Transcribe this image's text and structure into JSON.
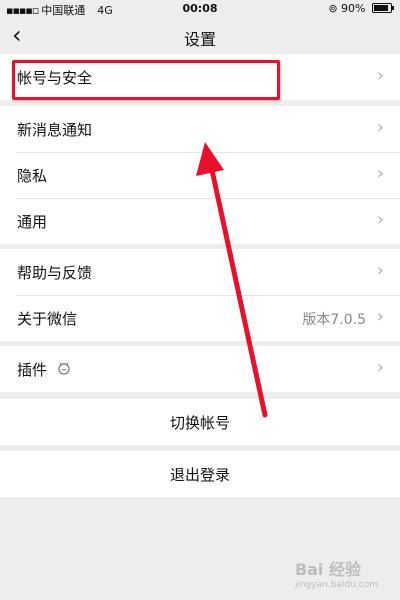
{
  "status_bar": {
    "carrier": "中国联通",
    "network": "4G",
    "time": "00:08",
    "battery": "90%",
    "battery_level": 0.9
  },
  "header": {
    "title": "设置"
  },
  "groups": {
    "account": {
      "label": "帐号与安全"
    },
    "main": [
      {
        "label": "新消息通知"
      },
      {
        "label": "隐私"
      },
      {
        "label": "通用"
      }
    ],
    "about": [
      {
        "label": "帮助与反馈"
      },
      {
        "label": "关于微信",
        "value": "版本7.0.5"
      }
    ],
    "plugins": {
      "label": "插件"
    }
  },
  "actions": {
    "switch_account": "切换帐号",
    "logout": "退出登录"
  },
  "watermark": {
    "text": "Bai 经验",
    "url_text": "jingyan.baidu.com"
  },
  "colors": {
    "background": "#ededed",
    "cell": "#ffffff",
    "annotation_red": "#e8102a",
    "chevron": "#b3b3b3"
  }
}
